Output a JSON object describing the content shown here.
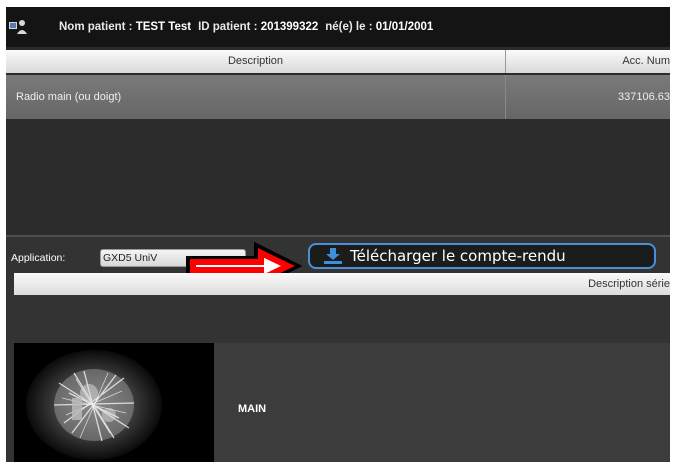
{
  "header": {
    "patient_name_label": "Nom patient :",
    "patient_name": "TEST Test",
    "patient_id_label": "ID patient :",
    "patient_id": "201399322",
    "birth_label": "né(e) le :",
    "birth_date": "01/01/2001"
  },
  "study_table": {
    "columns": [
      "Description",
      "Acc. Num"
    ],
    "rows": [
      {
        "description": "Radio main (ou doigt)",
        "acc_num": "337106.63"
      }
    ]
  },
  "application": {
    "label": "Application:",
    "selected": "GXD5 UniV"
  },
  "download_button": {
    "label": "Télécharger le compte-rendu",
    "icon": "download-icon",
    "border_color": "#4a90d9"
  },
  "series_table": {
    "column": "Description série",
    "rows": [
      {
        "description": "MAIN",
        "thumbnail": "hand-xray-thumbnail"
      }
    ]
  },
  "annotation": {
    "type": "red-arrow",
    "color": "#ff0000"
  }
}
